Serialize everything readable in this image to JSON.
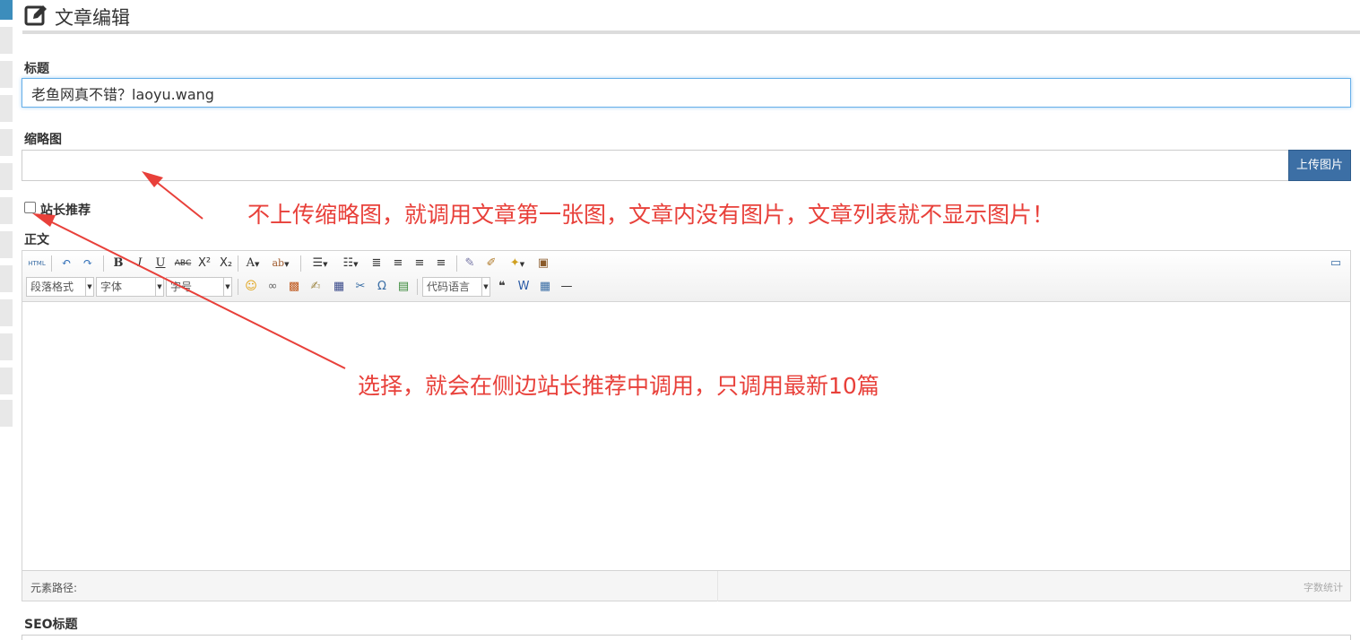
{
  "header": {
    "title": "文章编辑",
    "icon": "edit-icon"
  },
  "form": {
    "title_label": "标题",
    "title_value": "老鱼网真不错？laoyu.wang",
    "thumb_label": "缩略图",
    "thumb_value": "",
    "upload_label": "上传图片",
    "recommend_label": "站长推荐",
    "recommend_checked": false,
    "body_label": "正文",
    "seo_label": "SEO标题"
  },
  "editor": {
    "html_label": "HTML",
    "paragraph_format": "段落格式",
    "font_family": "字体",
    "font_size": "字号",
    "code_language": "代码语言",
    "path_label": "元素路径:",
    "wordcount_label": "字数统计",
    "toolbar_row1": [
      "source-html",
      "undo",
      "redo",
      "bold",
      "italic",
      "underline",
      "strikethrough",
      "superscript",
      "subscript",
      "font-color",
      "background-color",
      "ordered-list",
      "unordered-list",
      "indent",
      "align-left",
      "align-center",
      "align-right",
      "eraser",
      "format-painter",
      "auto-format",
      "paste-text",
      "fullscreen"
    ],
    "toolbar_row2": [
      "emoticon",
      "link",
      "insert-image",
      "scrawl",
      "video",
      "attachment",
      "special-char",
      "template",
      "blockquote",
      "word-image",
      "table",
      "horizontal-rule"
    ]
  },
  "annotations": {
    "thumb_note": "不上传缩略图，就调用文章第一张图，文章内没有图片，文章列表就不显示图片！",
    "recommend_note": "选择，就会在侧边站长推荐中调用，只调用最新10篇",
    "color": "#e8403a"
  },
  "colors": {
    "accent": "#3c8dbc",
    "upload_button": "#3c6fa5"
  }
}
